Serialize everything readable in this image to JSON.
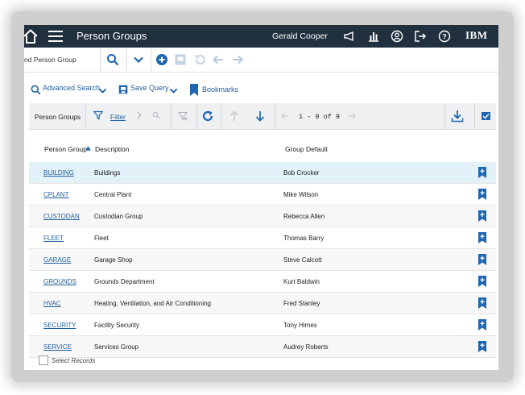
{
  "header": {
    "app_title": "Person Groups",
    "user_name": "Gerald Cooper",
    "brand": "IBM"
  },
  "find": {
    "value": "nd Person Group"
  },
  "query_bar": {
    "advanced_search": "Advanced Search",
    "save_query": "Save Query",
    "bookmarks": "Bookmarks"
  },
  "toolbar": {
    "table_title": "Person Groups",
    "filter_label": "Filter",
    "pagination": "1 - 9 of 9"
  },
  "table": {
    "columns": [
      "Person Group",
      "Description",
      "Group Default"
    ],
    "rows": [
      {
        "group": "BUILDING",
        "description": "Buildings",
        "default": "Bob Crocker"
      },
      {
        "group": "CPLANT",
        "description": "Central Plant",
        "default": "Mike Wilson"
      },
      {
        "group": "CUSTODAN",
        "description": "Custodian Group",
        "default": "Rebecca Allen"
      },
      {
        "group": "FLEET",
        "description": "Fleet",
        "default": "Thomas Barry"
      },
      {
        "group": "GARAGE",
        "description": "Garage Shop",
        "default": "Steve Calcott"
      },
      {
        "group": "GROUNDS",
        "description": "Grounds Department",
        "default": "Kurt Baldwin"
      },
      {
        "group": "HVAC",
        "description": "Heating, Ventilation, and Air Conditioning",
        "default": "Fred Stanley"
      },
      {
        "group": "SECURITY",
        "description": "Facility Security",
        "default": "Tony Himes"
      },
      {
        "group": "SERVICE",
        "description": "Services Group",
        "default": "Audrey Roberts"
      }
    ],
    "selected_row": 0
  },
  "footer": {
    "select_records": "Select Records"
  },
  "colors": {
    "topbar": "#21303f",
    "link": "#1f5e9e",
    "accent": "#1f66b0",
    "selected_row": "#e3f2f9"
  }
}
